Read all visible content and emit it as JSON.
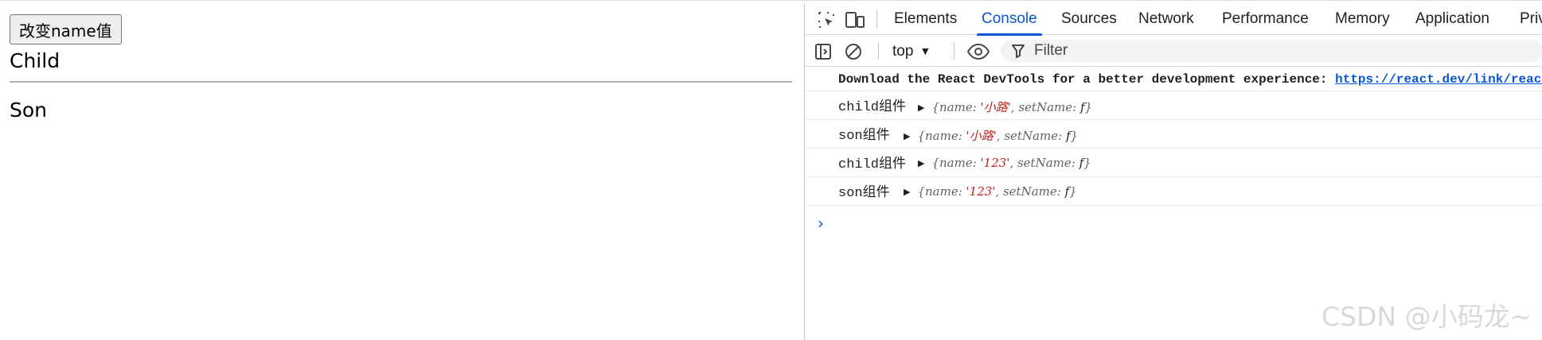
{
  "page": {
    "button_label": "改变name值",
    "child_text": "Child",
    "son_text": "Son"
  },
  "devtools": {
    "tabs": [
      {
        "label": "Elements",
        "active": false
      },
      {
        "label": "Console",
        "active": true
      },
      {
        "label": "Sources",
        "active": false
      },
      {
        "label": "Network",
        "active": false
      },
      {
        "label": "Performance",
        "active": false
      },
      {
        "label": "Memory",
        "active": false
      },
      {
        "label": "Application",
        "active": false
      },
      {
        "label": "Privacy",
        "active": false
      }
    ],
    "toolbar": {
      "context": "top",
      "filter_placeholder": "Filter"
    },
    "console": {
      "banner_text": "Download the React DevTools for a better development experience: ",
      "banner_link": "https://react.dev/link/react-devtools",
      "logs": [
        {
          "label": "child组件",
          "name": "'小路'",
          "setter": "setName",
          "fn": "f"
        },
        {
          "label": "son组件",
          "name": "'小路'",
          "setter": "setName",
          "fn": "f"
        },
        {
          "label": "child组件",
          "name": "'123'",
          "setter": "setName",
          "fn": "f"
        },
        {
          "label": "son组件",
          "name": "'123'",
          "setter": "setName",
          "fn": "f"
        }
      ],
      "prompt": "›"
    },
    "accent_color": "#0b57d0",
    "string_color": "#c5221f"
  },
  "watermark": "CSDN @小码龙~"
}
